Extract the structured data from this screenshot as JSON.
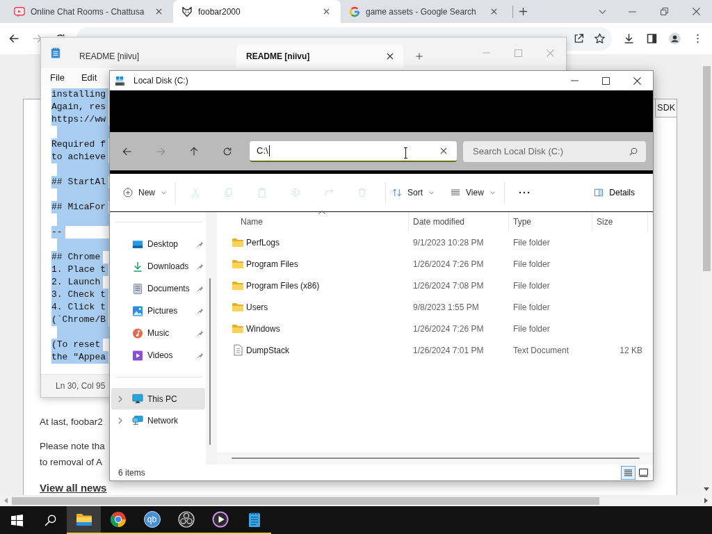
{
  "browser": {
    "tabs": [
      {
        "kind": "chat",
        "title": "Online Chat Rooms - Chattusa",
        "selected": false
      },
      {
        "kind": "fox",
        "title": "foobar2000",
        "selected": true
      },
      {
        "kind": "search",
        "title": "game assets - Google Search",
        "selected": false
      }
    ],
    "nav": {
      "back_disabled": false,
      "forward_disabled": true
    },
    "page": {
      "tab": "SDK",
      "paragraphs": [
        [
          "At last, foobar2"
        ],
        [
          "Please note tha",
          "to removal of A"
        ]
      ],
      "link": "View all news"
    }
  },
  "notepad": {
    "tabs": [
      {
        "title": "README [niivu]",
        "selected": false
      },
      {
        "title": "README [niivu]",
        "selected": true
      }
    ],
    "menu": [
      "File",
      "Edit"
    ],
    "text_selected": true,
    "blocks": [
      [
        "installing",
        "Again, res",
        "https://ww"
      ],
      [
        "Required f",
        "to achieve"
      ],
      [
        "## StartAl"
      ],
      [
        "## MicaFor"
      ],
      [
        "--"
      ],
      [
        "## Chrome",
        "1. Place t",
        "2. Launch",
        "3. Check t",
        "4. Click t",
        "(`Chrome/B"
      ],
      [
        "(To reset",
        "the \"Appea"
      ]
    ],
    "status": "Ln 30, Col 95"
  },
  "explorer": {
    "title": "Local Disk (C:)",
    "nav_buttons": [
      {
        "kind": "back",
        "disabled": false
      },
      {
        "kind": "forward",
        "disabled": true
      },
      {
        "kind": "up",
        "disabled": false
      },
      {
        "kind": "refresh",
        "disabled": false
      }
    ],
    "address": {
      "value": "C:\\"
    },
    "search": {
      "placeholder": "Search Local Disk (C:)"
    },
    "command_groups": [
      [
        {
          "kind": "new",
          "label": "New",
          "disabled": false,
          "dropdown": true
        }
      ],
      [
        {
          "kind": "cut",
          "disabled": true,
          "dropdown": false
        },
        {
          "kind": "copy",
          "disabled": true,
          "dropdown": false
        },
        {
          "kind": "paste",
          "disabled": true,
          "dropdown": false
        },
        {
          "kind": "rename",
          "disabled": true,
          "dropdown": false
        },
        {
          "kind": "share",
          "disabled": true,
          "dropdown": false
        },
        {
          "kind": "delete",
          "disabled": true,
          "dropdown": false
        }
      ],
      [
        {
          "kind": "sort",
          "label": "Sort",
          "disabled": false,
          "dropdown": true
        },
        {
          "kind": "view",
          "label": "View",
          "disabled": false,
          "dropdown": true
        }
      ],
      [
        {
          "kind": "more",
          "disabled": false,
          "dropdown": false
        }
      ]
    ],
    "details_button": {
      "label": "Details"
    },
    "quick_access": [
      {
        "kind": "desktop",
        "label": "Desktop",
        "pinned": true
      },
      {
        "kind": "downloads",
        "label": "Downloads",
        "pinned": true
      },
      {
        "kind": "documents",
        "label": "Documents",
        "pinned": true
      },
      {
        "kind": "pictures",
        "label": "Pictures",
        "pinned": true
      },
      {
        "kind": "music",
        "label": "Music",
        "pinned": true
      },
      {
        "kind": "videos",
        "label": "Videos",
        "pinned": true
      }
    ],
    "tree": [
      {
        "kind": "pc",
        "label": "This PC",
        "selected": true,
        "expanded": false
      },
      {
        "kind": "network",
        "label": "Network",
        "selected": false,
        "expanded": false
      }
    ],
    "columns": [
      {
        "label": "Name",
        "sorted": true
      },
      {
        "label": "Date modified",
        "sorted": false
      },
      {
        "label": "Type",
        "sorted": false
      },
      {
        "label": "Size",
        "sorted": false
      }
    ],
    "rows": [
      {
        "kind": "folder",
        "name": "PerfLogs",
        "date": "9/1/2023 10:28 PM",
        "type": "File folder"
      },
      {
        "kind": "folder",
        "name": "Program Files",
        "date": "1/26/2024 7:26 PM",
        "type": "File folder"
      },
      {
        "kind": "folder",
        "name": "Program Files (x86)",
        "date": "1/26/2024 7:08 PM",
        "type": "File folder"
      },
      {
        "kind": "folder",
        "name": "Users",
        "date": "9/8/2023 1:55 PM",
        "type": "File folder"
      },
      {
        "kind": "folder",
        "name": "Windows",
        "date": "1/26/2024 7:26 PM",
        "type": "File folder"
      },
      {
        "kind": "file",
        "name": "DumpStack",
        "date": "1/26/2024 7:01 PM",
        "type": "Text Document",
        "size": "12 KB"
      }
    ],
    "status": "6 items",
    "views": [
      {
        "kind": "details",
        "selected": true
      },
      {
        "kind": "tiles",
        "selected": false
      }
    ]
  },
  "taskbar": {
    "apps": [
      {
        "kind": "files",
        "selected": true,
        "running": true
      },
      {
        "kind": "browser",
        "selected": false,
        "running": true
      },
      {
        "kind": "torrent",
        "label": "qb",
        "selected": false,
        "running": true
      },
      {
        "kind": "recorder",
        "selected": false,
        "running": true
      },
      {
        "kind": "player",
        "selected": false,
        "running": true
      },
      {
        "kind": "notepad",
        "selected": false,
        "running": true
      }
    ]
  }
}
